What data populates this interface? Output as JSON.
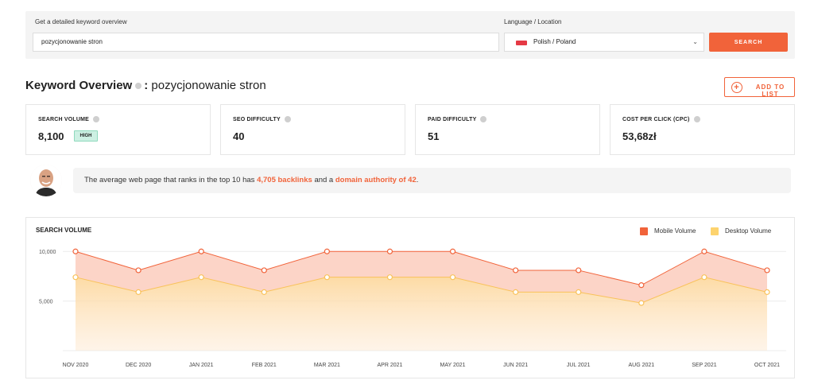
{
  "search": {
    "label": "Get a detailed keyword overview",
    "value": "pozycjonowanie stron",
    "language_label": "Language / Location",
    "language_value": "Polish / Poland",
    "button": "SEARCH"
  },
  "overview": {
    "title": "Keyword Overview",
    "separator": ":",
    "keyword": "pozycjonowanie stron",
    "add_button": "ADD TO LIST"
  },
  "metrics": [
    {
      "label": "SEARCH VOLUME",
      "value": "8,100",
      "badge": "HIGH"
    },
    {
      "label": "SEO DIFFICULTY",
      "value": "40"
    },
    {
      "label": "PAID DIFFICULTY",
      "value": "51"
    },
    {
      "label": "COST PER CLICK (CPC)",
      "value": "53,68zł"
    }
  ],
  "tip": {
    "prefix": "The average web page that ranks in the top 10 has",
    "backlinks": "4,705 backlinks",
    "middle": "and a",
    "authority": "domain authority of 42",
    "suffix": "."
  },
  "colors": {
    "accent": "#f1633a",
    "mobile": "#f1633a",
    "desktop": "#fdd36e",
    "badge_bg": "#cdf0e3"
  },
  "chart_data": {
    "type": "area",
    "title": "SEARCH VOLUME",
    "categories": [
      "NOV 2020",
      "DEC 2020",
      "JAN 2021",
      "FEB 2021",
      "MAR 2021",
      "APR 2021",
      "MAY 2021",
      "JUN 2021",
      "JUL 2021",
      "AUG 2021",
      "SEP 2021",
      "OCT 2021"
    ],
    "series": [
      {
        "name": "Mobile Volume",
        "values": [
          10000,
          8100,
          10000,
          8100,
          10000,
          10000,
          10000,
          8100,
          8100,
          6600,
          10000,
          8100
        ]
      },
      {
        "name": "Desktop Volume",
        "values": [
          7400,
          5900,
          7400,
          5900,
          7400,
          7400,
          7400,
          5900,
          5900,
          4800,
          7400,
          5900
        ]
      }
    ],
    "y_ticks": [
      {
        "value": 10000,
        "label": "10,000"
      },
      {
        "value": 5000,
        "label": "5,000"
      }
    ],
    "ylim": [
      0,
      10500
    ],
    "grid": true,
    "legend_position": "top-right"
  }
}
